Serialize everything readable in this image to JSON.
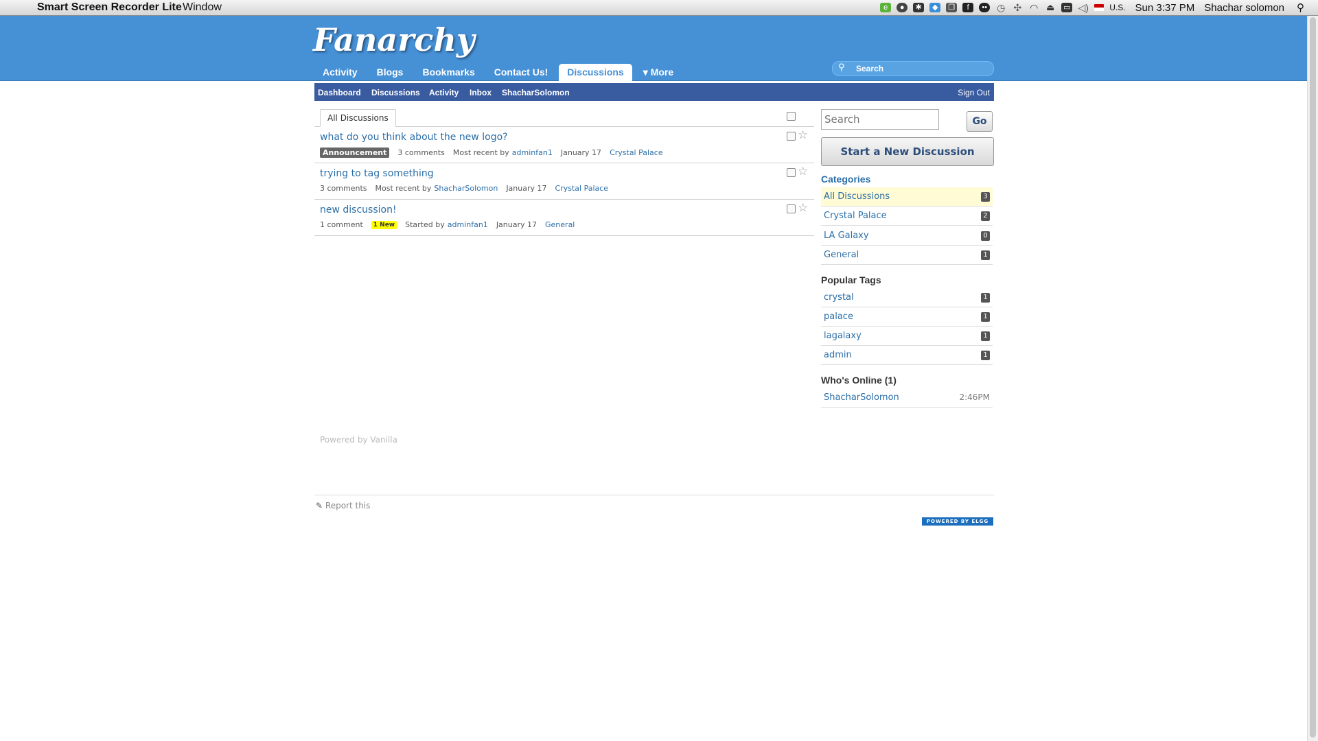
{
  "menubar": {
    "app_name": "Smart Screen Recorder Lite",
    "menu_window": "Window",
    "input_source": "U.S.",
    "clock": "Sun 3:37 PM",
    "user": "Shachar solomon"
  },
  "site": {
    "logo": "Fanarchy",
    "nav": [
      {
        "label": "Activity"
      },
      {
        "label": "Blogs"
      },
      {
        "label": "Bookmarks"
      },
      {
        "label": "Contact Us!"
      },
      {
        "label": "Discussions"
      },
      {
        "label": "▾ More"
      }
    ],
    "search_placeholder": "Search"
  },
  "vanilla_nav": {
    "items": [
      "Dashboard",
      "Discussions",
      "Activity",
      "Inbox",
      "ShacharSolomon"
    ],
    "sign_out": "Sign Out"
  },
  "main": {
    "tab": "All Discussions",
    "discussions": [
      {
        "title": "what do you think about the new logo?",
        "badge": "Announcement",
        "comments": "3 comments",
        "recent_prefix": "Most recent by",
        "author": "adminfan1",
        "date": "January 17",
        "category": "Crystal Palace"
      },
      {
        "title": "trying to tag something",
        "comments": "3 comments",
        "recent_prefix": "Most recent by",
        "author": "ShacharSolomon",
        "date": "January 17",
        "category": "Crystal Palace"
      },
      {
        "title": "new discussion!",
        "comments": "1 comment",
        "new_badge": "1 New",
        "recent_prefix": "Started by",
        "author": "adminfan1",
        "date": "January 17",
        "category": "General"
      }
    ],
    "powered_by": "Powered by Vanilla"
  },
  "sidebar": {
    "search_placeholder": "Search",
    "go_label": "Go",
    "new_discussion": "Start a New Discussion",
    "categories_heading": "Categories",
    "categories": [
      {
        "label": "All Discussions",
        "count": "3"
      },
      {
        "label": "Crystal Palace",
        "count": "2"
      },
      {
        "label": "LA Galaxy",
        "count": "0"
      },
      {
        "label": "General",
        "count": "1"
      }
    ],
    "tags_heading": "Popular Tags",
    "tags": [
      {
        "label": "crystal",
        "count": "1"
      },
      {
        "label": "palace",
        "count": "1"
      },
      {
        "label": "lagalaxy",
        "count": "1"
      },
      {
        "label": "admin",
        "count": "1"
      }
    ],
    "online_heading": "Who's Online (1)",
    "online": [
      {
        "name": "ShacharSolomon",
        "time": "2:46PM"
      }
    ]
  },
  "footer": {
    "report": "Report this",
    "elgg_badge": "POWERED BY ELGG"
  },
  "colors": {
    "header_blue": "#4690d6",
    "vanilla_bar": "#395ba0",
    "link": "#2b6ea8"
  },
  "icons": [
    "apple-icon",
    "search-icon",
    "star-icon",
    "wifi-icon",
    "volume-icon",
    "flag-icon",
    "report-icon"
  ]
}
